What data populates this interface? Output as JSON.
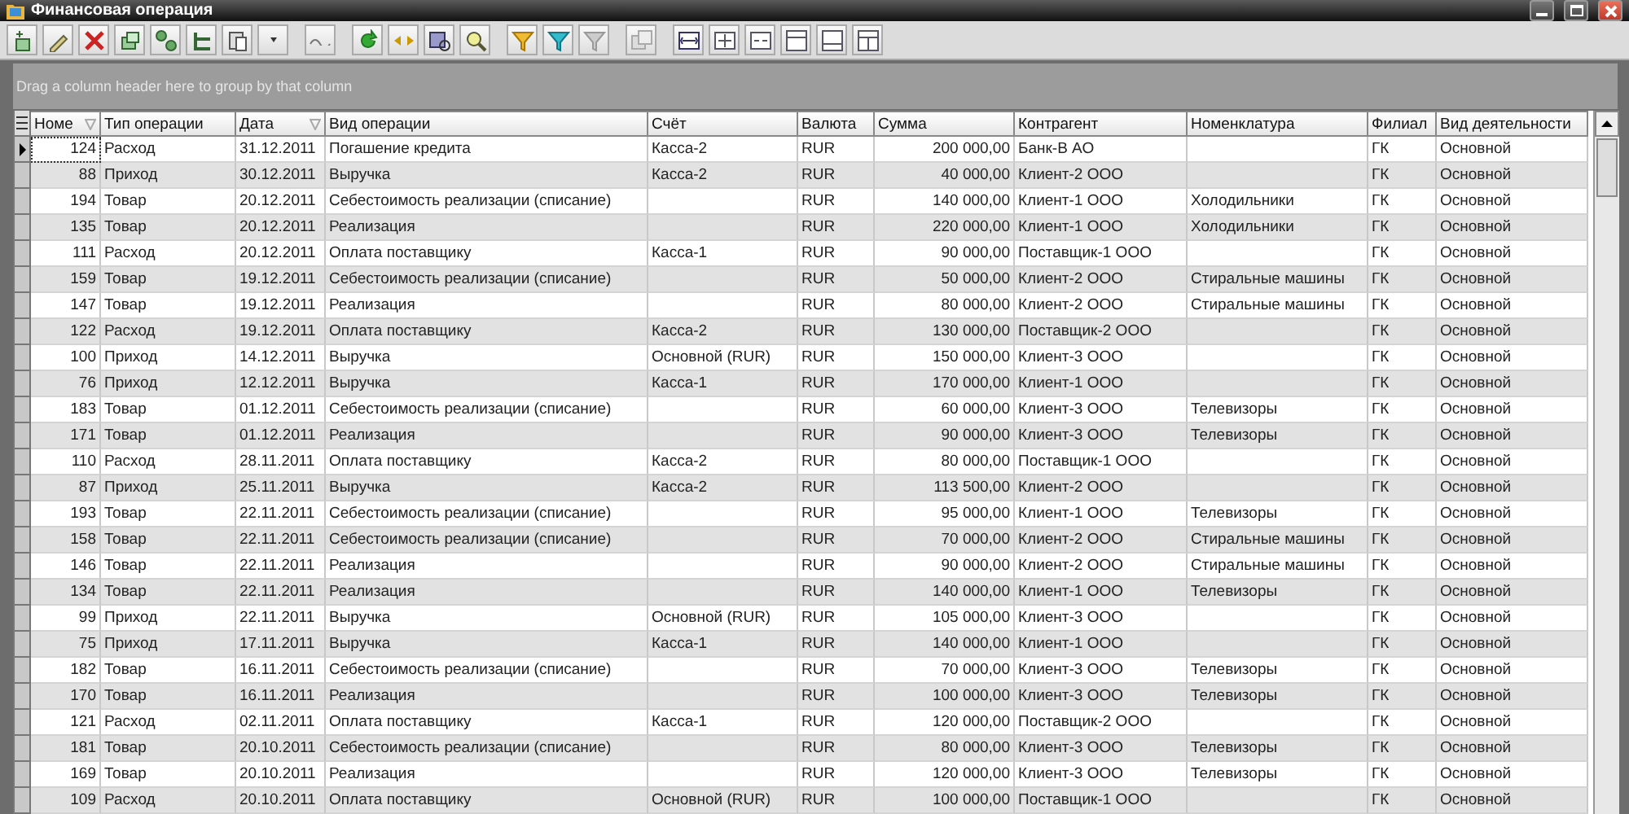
{
  "window": {
    "title": "Финансовая операция"
  },
  "group_panel": {
    "hint": "Drag a column header here to group by that column"
  },
  "table": {
    "columns": [
      {
        "label": "Номе",
        "filtered": true
      },
      {
        "label": "Тип операции",
        "filtered": false
      },
      {
        "label": "Дата",
        "filtered": true
      },
      {
        "label": "Вид операции",
        "filtered": false
      },
      {
        "label": "Счёт",
        "filtered": false
      },
      {
        "label": "Валюта",
        "filtered": false
      },
      {
        "label": "Сумма",
        "filtered": false
      },
      {
        "label": "Контрагент",
        "filtered": false
      },
      {
        "label": "Номенклатура",
        "filtered": false
      },
      {
        "label": "Филиал",
        "filtered": false
      },
      {
        "label": "Вид деятельности",
        "filtered": false
      }
    ],
    "rows": [
      {
        "selected": true,
        "number": "124",
        "type": "Расход",
        "date": "31.12.2011",
        "operation": "Погашение кредита",
        "account": "Касса-2",
        "currency": "RUR",
        "amount": "200 000,00",
        "counterparty": "Банк-В АО",
        "branch": "ГК",
        "activity": "Основной"
      },
      {
        "selected": false,
        "number": "88",
        "type": "Приход",
        "date": "30.12.2011",
        "operation": "Выручка",
        "account": "Касса-2",
        "currency": "RUR",
        "amount": "40 000,00",
        "counterparty": "Клиент-2 ООО",
        "branch": "ГК",
        "activity": "Основной"
      },
      {
        "selected": false,
        "number": "194",
        "type": "Товар",
        "date": "20.12.2011",
        "operation": "Себестоимость реализации (списание)",
        "currency": "RUR",
        "amount": "140 000,00",
        "counterparty": "Клиент-1 ООО",
        "nomenclature": "Холодильники",
        "branch": "ГК",
        "activity": "Основной"
      },
      {
        "selected": false,
        "number": "135",
        "type": "Товар",
        "date": "20.12.2011",
        "operation": "Реализация",
        "currency": "RUR",
        "amount": "220 000,00",
        "counterparty": "Клиент-1 ООО",
        "nomenclature": "Холодильники",
        "branch": "ГК",
        "activity": "Основной"
      },
      {
        "selected": false,
        "number": "111",
        "type": "Расход",
        "date": "20.12.2011",
        "operation": "Оплата поставщику",
        "account": "Касса-1",
        "currency": "RUR",
        "amount": "90 000,00",
        "counterparty": "Поставщик-1 ООО",
        "branch": "ГК",
        "activity": "Основной"
      },
      {
        "selected": false,
        "number": "159",
        "type": "Товар",
        "date": "19.12.2011",
        "operation": "Себестоимость реализации (списание)",
        "currency": "RUR",
        "amount": "50 000,00",
        "counterparty": "Клиент-2 ООО",
        "nomenclature": "Стиральные машины",
        "branch": "ГК",
        "activity": "Основной"
      },
      {
        "selected": false,
        "number": "147",
        "type": "Товар",
        "date": "19.12.2011",
        "operation": "Реализация",
        "currency": "RUR",
        "amount": "80 000,00",
        "counterparty": "Клиент-2 ООО",
        "nomenclature": "Стиральные машины",
        "branch": "ГК",
        "activity": "Основной"
      },
      {
        "selected": false,
        "number": "122",
        "type": "Расход",
        "date": "19.12.2011",
        "operation": "Оплата поставщику",
        "account": "Касса-2",
        "currency": "RUR",
        "amount": "130 000,00",
        "counterparty": "Поставщик-2 ООО",
        "branch": "ГК",
        "activity": "Основной"
      },
      {
        "selected": false,
        "number": "100",
        "type": "Приход",
        "date": "14.12.2011",
        "operation": "Выручка",
        "account": "Основной (RUR)",
        "currency": "RUR",
        "amount": "150 000,00",
        "counterparty": "Клиент-3 ООО",
        "branch": "ГК",
        "activity": "Основной"
      },
      {
        "selected": false,
        "number": "76",
        "type": "Приход",
        "date": "12.12.2011",
        "operation": "Выручка",
        "account": "Касса-1",
        "currency": "RUR",
        "amount": "170 000,00",
        "counterparty": "Клиент-1 ООО",
        "branch": "ГК",
        "activity": "Основной"
      },
      {
        "selected": false,
        "number": "183",
        "type": "Товар",
        "date": "01.12.2011",
        "operation": "Себестоимость реализации (списание)",
        "currency": "RUR",
        "amount": "60 000,00",
        "counterparty": "Клиент-3 ООО",
        "nomenclature": "Телевизоры",
        "branch": "ГК",
        "activity": "Основной"
      },
      {
        "selected": false,
        "number": "171",
        "type": "Товар",
        "date": "01.12.2011",
        "operation": "Реализация",
        "currency": "RUR",
        "amount": "90 000,00",
        "counterparty": "Клиент-3 ООО",
        "nomenclature": "Телевизоры",
        "branch": "ГК",
        "activity": "Основной"
      },
      {
        "selected": false,
        "number": "110",
        "type": "Расход",
        "date": "28.11.2011",
        "operation": "Оплата поставщику",
        "account": "Касса-2",
        "currency": "RUR",
        "amount": "80 000,00",
        "counterparty": "Поставщик-1 ООО",
        "branch": "ГК",
        "activity": "Основной"
      },
      {
        "selected": false,
        "number": "87",
        "type": "Приход",
        "date": "25.11.2011",
        "operation": "Выручка",
        "account": "Касса-2",
        "currency": "RUR",
        "amount": "113 500,00",
        "counterparty": "Клиент-2 ООО",
        "branch": "ГК",
        "activity": "Основной"
      },
      {
        "selected": false,
        "number": "193",
        "type": "Товар",
        "date": "22.11.2011",
        "operation": "Себестоимость реализации (списание)",
        "currency": "RUR",
        "amount": "95 000,00",
        "counterparty": "Клиент-1 ООО",
        "nomenclature": "Телевизоры",
        "branch": "ГК",
        "activity": "Основной"
      },
      {
        "selected": false,
        "number": "158",
        "type": "Товар",
        "date": "22.11.2011",
        "operation": "Себестоимость реализации (списание)",
        "currency": "RUR",
        "amount": "70 000,00",
        "counterparty": "Клиент-2 ООО",
        "nomenclature": "Стиральные машины",
        "branch": "ГК",
        "activity": "Основной"
      },
      {
        "selected": false,
        "number": "146",
        "type": "Товар",
        "date": "22.11.2011",
        "operation": "Реализация",
        "currency": "RUR",
        "amount": "90 000,00",
        "counterparty": "Клиент-2 ООО",
        "nomenclature": "Стиральные машины",
        "branch": "ГК",
        "activity": "Основной"
      },
      {
        "selected": false,
        "number": "134",
        "type": "Товар",
        "date": "22.11.2011",
        "operation": "Реализация",
        "currency": "RUR",
        "amount": "140 000,00",
        "counterparty": "Клиент-1 ООО",
        "nomenclature": "Телевизоры",
        "branch": "ГК",
        "activity": "Основной"
      },
      {
        "selected": false,
        "number": "99",
        "type": "Приход",
        "date": "22.11.2011",
        "operation": "Выручка",
        "account": "Основной (RUR)",
        "currency": "RUR",
        "amount": "105 000,00",
        "counterparty": "Клиент-3 ООО",
        "branch": "ГК",
        "activity": "Основной"
      },
      {
        "selected": false,
        "number": "75",
        "type": "Приход",
        "date": "17.11.2011",
        "operation": "Выручка",
        "account": "Касса-1",
        "currency": "RUR",
        "amount": "140 000,00",
        "counterparty": "Клиент-1 ООО",
        "branch": "ГК",
        "activity": "Основной"
      },
      {
        "selected": false,
        "number": "182",
        "type": "Товар",
        "date": "16.11.2011",
        "operation": "Себестоимость реализации (списание)",
        "currency": "RUR",
        "amount": "70 000,00",
        "counterparty": "Клиент-3 ООО",
        "nomenclature": "Телевизоры",
        "branch": "ГК",
        "activity": "Основной"
      },
      {
        "selected": false,
        "number": "170",
        "type": "Товар",
        "date": "16.11.2011",
        "operation": "Реализация",
        "currency": "RUR",
        "amount": "100 000,00",
        "counterparty": "Клиент-3 ООО",
        "nomenclature": "Телевизоры",
        "branch": "ГК",
        "activity": "Основной"
      },
      {
        "selected": false,
        "number": "121",
        "type": "Расход",
        "date": "02.11.2011",
        "operation": "Оплата поставщику",
        "account": "Касса-1",
        "currency": "RUR",
        "amount": "120 000,00",
        "counterparty": "Поставщик-2 ООО",
        "branch": "ГК",
        "activity": "Основной"
      },
      {
        "selected": false,
        "number": "181",
        "type": "Товар",
        "date": "20.10.2011",
        "operation": "Себестоимость реализации (списание)",
        "currency": "RUR",
        "amount": "80 000,00",
        "counterparty": "Клиент-3 ООО",
        "nomenclature": "Телевизоры",
        "branch": "ГК",
        "activity": "Основной"
      },
      {
        "selected": false,
        "number": "169",
        "type": "Товар",
        "date": "20.10.2011",
        "operation": "Реализация",
        "currency": "RUR",
        "amount": "120 000,00",
        "counterparty": "Клиент-3 ООО",
        "nomenclature": "Телевизоры",
        "branch": "ГК",
        "activity": "Основной"
      },
      {
        "selected": false,
        "number": "109",
        "type": "Расход",
        "date": "20.10.2011",
        "operation": "Оплата поставщику",
        "account": "Основной (RUR)",
        "currency": "RUR",
        "amount": "100 000,00",
        "counterparty": "Поставщик-1 ООО",
        "branch": "ГК",
        "activity": "Основной"
      }
    ]
  }
}
